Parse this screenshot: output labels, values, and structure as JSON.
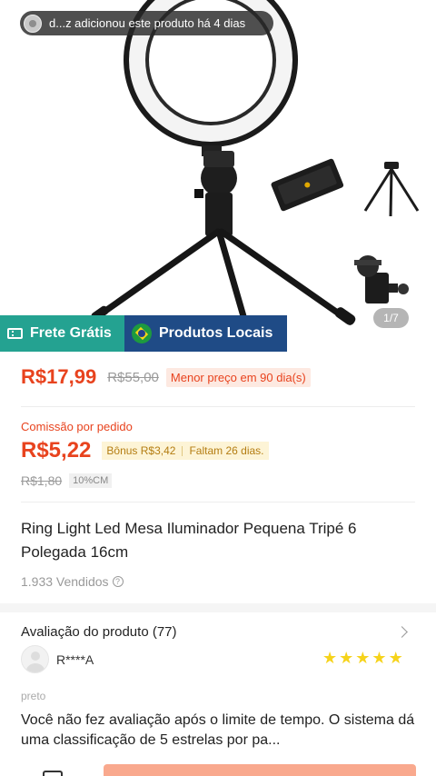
{
  "notification": {
    "text": "d...z adicionou este produto há 4 dias"
  },
  "gallery": {
    "page_indicator": "1/7"
  },
  "badges": {
    "free_shipping": "Frete Grátis",
    "local_products": "Produtos Locais"
  },
  "price": {
    "current": "R$17,99",
    "original": "R$55,00",
    "lowest_tag": "Menor preço em 90 dia(s)"
  },
  "commission": {
    "label": "Comissão por pedido",
    "value": "R$5,22",
    "bonus": "Bônus R$3,42",
    "remaining": "Faltam 26 dias.",
    "old_value": "R$1,80",
    "rate_tag": "10%CM"
  },
  "product": {
    "title": "Ring Light Led Mesa Iluminador Pequena Tripé 6 Polegada 16cm",
    "sold": "1.933 Vendidos",
    "help_icon": "?"
  },
  "reviews": {
    "title": "Avaliação do produto (77)",
    "reviewer": "R****A",
    "rating": 5,
    "star_glyph": "★",
    "variant": "preto",
    "text": "Você não fez avaliação após o limite de tempo. O sistema dá uma classificação de 5 estrelas por pa..."
  },
  "colors": {
    "accent": "#e8431e",
    "free_shipping": "#24a291",
    "local": "#1f4b86",
    "star": "#f6d31b"
  }
}
